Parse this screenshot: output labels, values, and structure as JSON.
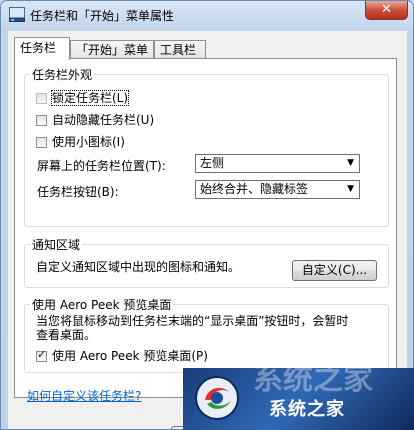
{
  "window": {
    "title": "任务栏和「开始」菜单属性",
    "close_symbol": "✕"
  },
  "tabs": [
    {
      "label": "任务栏",
      "active": true
    },
    {
      "label": "「开始」菜单",
      "active": false
    },
    {
      "label": "工具栏",
      "active": false
    }
  ],
  "appearance": {
    "group_label": "任务栏外观",
    "lock": {
      "label": "锁定任务栏(L)",
      "checked": false,
      "disabled": true
    },
    "autohide": {
      "label": "自动隐藏任务栏(U)",
      "checked": false
    },
    "small_icons": {
      "label": "使用小图标(I)",
      "checked": false
    },
    "position_label": "屏幕上的任务栏位置(T):",
    "position_value": "左侧",
    "buttons_label": "任务栏按钮(B):",
    "buttons_value": "始终合并、隐藏标签"
  },
  "notification": {
    "group_label": "通知区域",
    "description": "自定义通知区域中出现的图标和通知。",
    "customize_button": "自定义(C)..."
  },
  "aero_peek": {
    "group_label": "使用 Aero Peek 预览桌面",
    "description_line1": "当您将鼠标移动到任务栏末端的“显示桌面”按钮时，会暂时",
    "description_line2": "查看桌面。",
    "checkbox": {
      "label": "使用 Aero Peek 预览桌面(P)",
      "checked": true
    }
  },
  "help_link": "如何自定义该任务栏?",
  "watermark": {
    "text": "系统之家",
    "top_text": "系统之家"
  },
  "colors": {
    "link": "#0066cc",
    "close_button": "#c9503b"
  }
}
